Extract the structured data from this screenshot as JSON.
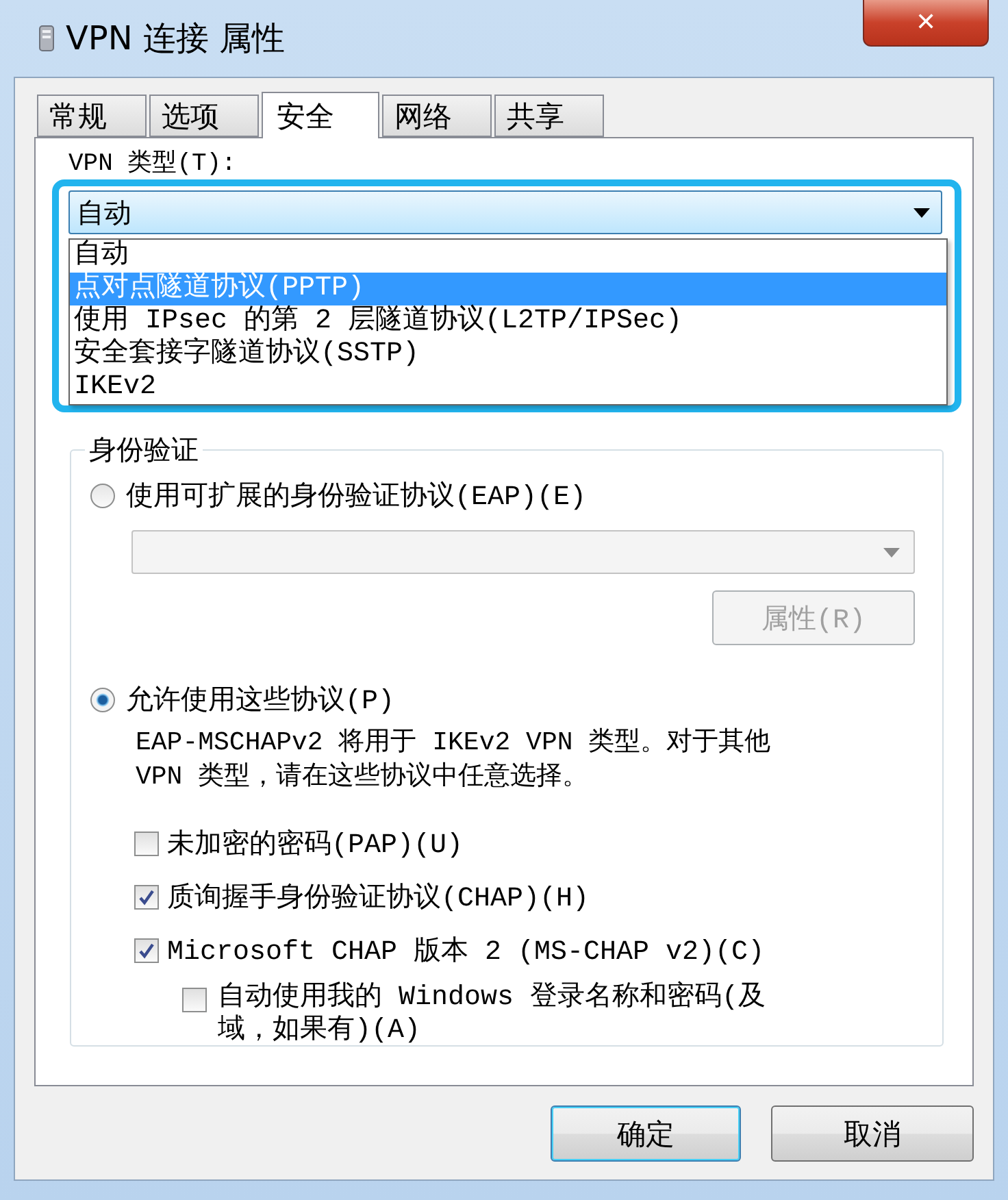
{
  "window": {
    "title": "VPN 连接 属性",
    "close_label": "✕"
  },
  "tabs": [
    {
      "label": "常规",
      "selected": false
    },
    {
      "label": "选项",
      "selected": false
    },
    {
      "label": "安全",
      "selected": true
    },
    {
      "label": "网络",
      "selected": false
    },
    {
      "label": "共享",
      "selected": false
    }
  ],
  "vpn_type": {
    "label": "VPN 类型(T):",
    "value": "自动",
    "expanded": true,
    "options": [
      {
        "label": "自动",
        "highlighted": false
      },
      {
        "label": "点对点隧道协议(PPTP)",
        "highlighted": true
      },
      {
        "label": "使用 IPsec 的第 2 层隧道协议(L2TP/IPSec)",
        "highlighted": false
      },
      {
        "label": "安全套接字隧道协议(SSTP)",
        "highlighted": false
      },
      {
        "label": "IKEv2",
        "highlighted": false
      }
    ]
  },
  "authentication": {
    "title": "身份验证",
    "eap": {
      "label": "使用可扩展的身份验证协议(EAP)(E)",
      "selected": false,
      "method_disabled": true,
      "properties_button": {
        "label": "属性(R)",
        "disabled": true
      }
    },
    "allow": {
      "label": "允许使用这些协议(P)",
      "selected": true,
      "note": "EAP-MSCHAPv2 将用于 IKEv2 VPN 类型。对于其他 VPN 类型，请在这些协议中任意选择。"
    },
    "protocols": [
      {
        "label": "未加密的密码(PAP)(U)",
        "checked": false
      },
      {
        "label": "质询握手身份验证协议(CHAP)(H)",
        "checked": true
      },
      {
        "label": "Microsoft CHAP 版本 2 (MS-CHAP v2)(C)",
        "checked": true,
        "children": [
          {
            "label": "自动使用我的 Windows 登录名称和密码(及域，如果有)(A)",
            "checked": false
          }
        ]
      }
    ]
  },
  "buttons": [
    {
      "label": "确定",
      "default": true
    },
    {
      "label": "取消",
      "default": false
    }
  ]
}
